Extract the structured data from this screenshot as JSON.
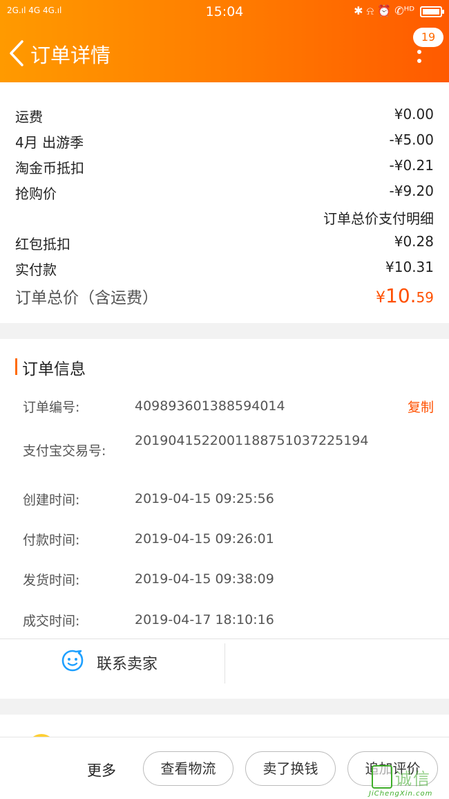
{
  "status_bar": {
    "signal_left": "2G.ıl 4G 4G.ıl",
    "time": "15:04",
    "right_icons": "✱ ⍾ ⏰ ✆ᴴᴰ"
  },
  "header": {
    "title": "订单详情",
    "badge_count": "19"
  },
  "price": {
    "rows": [
      {
        "label": "运费",
        "value": "¥0.00"
      },
      {
        "label": "4月 出游季",
        "value": "-¥5.00"
      },
      {
        "label": "淘金币抵扣",
        "value": "-¥0.21"
      },
      {
        "label": "抢购价",
        "value": "-¥9.20"
      },
      {
        "label": "",
        "value": "订单总价支付明细"
      },
      {
        "label": "红包抵扣",
        "value": "¥0.28"
      },
      {
        "label": "实付款",
        "value": "¥10.31"
      }
    ],
    "total_label": "订单总价（含运费）",
    "total_currency": "¥",
    "total_integer": "10.",
    "total_decimal": "59"
  },
  "order_info": {
    "title": "订单信息",
    "copy_label": "复制",
    "rows": [
      {
        "key": "订单编号:",
        "value": "409893601388594014"
      },
      {
        "key": "支付宝交易号:",
        "value": "2019041522001188751037225194"
      },
      {
        "key": "创建时间:",
        "value": "2019-04-15 09:25:56"
      },
      {
        "key": "付款时间:",
        "value": "2019-04-15 09:26:01"
      },
      {
        "key": "发货时间:",
        "value": "2019-04-15 09:38:09"
      },
      {
        "key": "成交时间:",
        "value": "2019-04-17 18:10:16"
      }
    ],
    "contact_label": "联系卖家"
  },
  "bottom_bar": {
    "more": "更多",
    "buttons": [
      "查看物流",
      "卖了换钱",
      "追加评价"
    ]
  },
  "watermark": {
    "text": "诚信",
    "url": "JiChengXin.com"
  },
  "colors": {
    "accent": "#ff5000",
    "header_start": "#ff9a00",
    "header_end": "#ff5a00",
    "contact_icon": "#1ea0ff"
  }
}
